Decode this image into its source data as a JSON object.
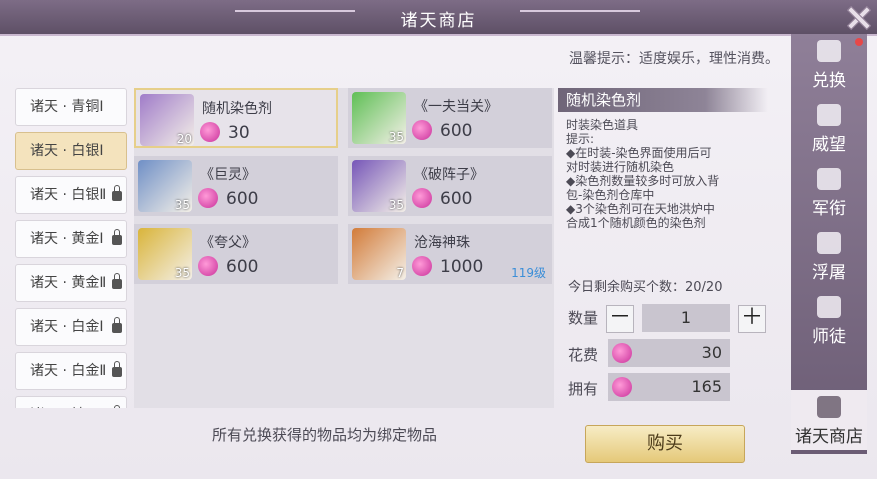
{
  "window": {
    "title": "诸天商店"
  },
  "tip": "温馨提示：适度娱乐，理性消费。",
  "tiers": [
    {
      "label": "诸天 · 青铜Ⅰ",
      "locked": false,
      "active": false
    },
    {
      "label": "诸天 · 白银Ⅰ",
      "locked": false,
      "active": true
    },
    {
      "label": "诸天 · 白银Ⅱ",
      "locked": true,
      "active": false
    },
    {
      "label": "诸天 · 黄金Ⅰ",
      "locked": true,
      "active": false
    },
    {
      "label": "诸天 · 黄金Ⅱ",
      "locked": true,
      "active": false
    },
    {
      "label": "诸天 · 白金Ⅰ",
      "locked": true,
      "active": false
    },
    {
      "label": "诸天 · 白金Ⅱ",
      "locked": true,
      "active": false
    },
    {
      "label": "诸天 · 钻石Ⅰ",
      "locked": true,
      "active": false
    }
  ],
  "items": [
    {
      "name": "随机染色剂",
      "price": "30",
      "level": "20",
      "req": "",
      "icon": "potion-icon",
      "color": "#a07cc9"
    },
    {
      "name": "《一夫当关》",
      "price": "600",
      "level": "35",
      "req": "",
      "icon": "scroll-green-icon",
      "color": "#5fbf55"
    },
    {
      "name": "《巨灵》",
      "price": "600",
      "level": "35",
      "req": "",
      "icon": "scroll-blue-icon",
      "color": "#6f8fc6"
    },
    {
      "name": "《破阵子》",
      "price": "600",
      "level": "35",
      "req": "",
      "icon": "scroll-purple-icon",
      "color": "#7656b8"
    },
    {
      "name": "《夸父》",
      "price": "600",
      "level": "35",
      "req": "",
      "icon": "scroll-yellow-icon",
      "color": "#d9b43a"
    },
    {
      "name": "沧海神珠",
      "price": "1000",
      "level": "7",
      "req": "119级",
      "icon": "pearl-icon",
      "color": "#d27b39"
    }
  ],
  "detail": {
    "title": "随机染色剂",
    "desc": [
      "时装染色道具",
      "提示:",
      "◆在时装-染色界面使用后可",
      "对时装进行随机染色",
      "◆染色剂数量较多时可放入背",
      "包-染色剂仓库中",
      "◆3个染色剂可在天地洪炉中",
      "合成1个随机颜色的染色剂"
    ],
    "remain": "今日剩余购买个数：20/20",
    "qty_label": "数量",
    "qty": "1",
    "minus": "－",
    "plus": "＋",
    "cost_label": "花费",
    "cost": "30",
    "own_label": "拥有",
    "own": "165"
  },
  "buy_label": "购买",
  "notice": "所有兑换获得的物品均为绑定物品",
  "rtabs": [
    {
      "label": "兑换",
      "icon": "scales-icon",
      "active": false,
      "dot": true
    },
    {
      "label": "威望",
      "icon": "wings-icon",
      "active": false,
      "dot": false
    },
    {
      "label": "军衔",
      "icon": "star-icon",
      "active": false,
      "dot": false
    },
    {
      "label": "浮屠",
      "icon": "pagoda-icon",
      "active": false,
      "dot": false
    },
    {
      "label": "师徒",
      "icon": "book-icon",
      "active": false,
      "dot": false
    },
    {
      "label": "诸天商店",
      "icon": "emblem-icon",
      "active": true,
      "dot": false
    }
  ]
}
